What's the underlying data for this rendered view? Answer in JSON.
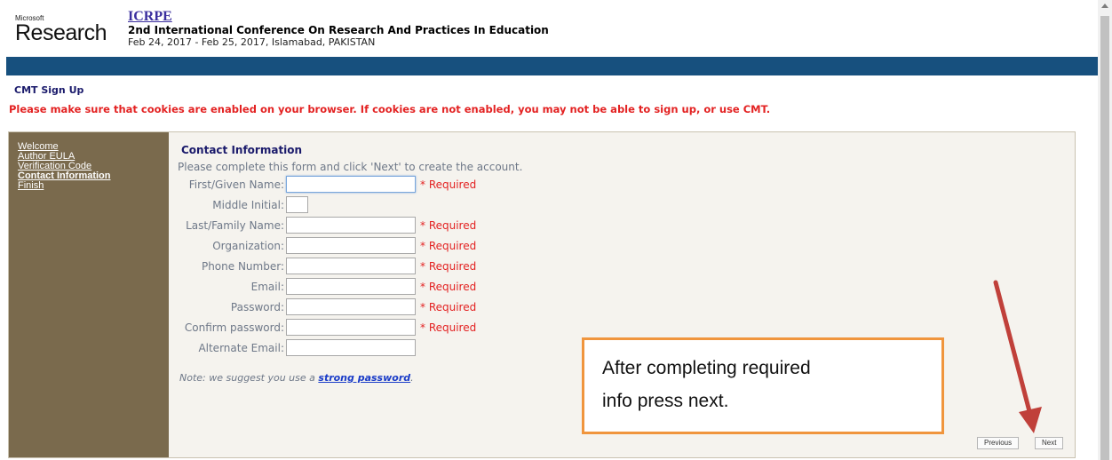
{
  "header": {
    "logo_small": "Microsoft",
    "logo_big": "Research",
    "conference_acronym": "ICRPE",
    "conference_name": "2nd International Conference On Research And Practices In Education",
    "conference_dates": "Feb 24, 2017 - Feb 25, 2017, Islamabad, PAKISTAN"
  },
  "page_title": "CMT Sign Up",
  "warning": "Please make sure that cookies are enabled on your browser. If cookies are not enabled, you may not be able to sign up, or use CMT.",
  "sidebar": {
    "items": [
      {
        "label": "Welcome"
      },
      {
        "label": "Author EULA"
      },
      {
        "label": "Verification Code"
      },
      {
        "label": "Contact Information"
      },
      {
        "label": "Finish"
      }
    ]
  },
  "form": {
    "title": "Contact Information",
    "instructions": "Please complete this form and click 'Next' to create the account.",
    "required_text": "* Required",
    "fields": [
      {
        "label": "First/Given Name:",
        "value": ""
      },
      {
        "label": "Middle Initial:",
        "value": ""
      },
      {
        "label": "Last/Family Name:",
        "value": ""
      },
      {
        "label": "Organization:",
        "value": ""
      },
      {
        "label": "Phone Number:",
        "value": ""
      },
      {
        "label": "Email:",
        "value": ""
      },
      {
        "label": "Password:",
        "value": ""
      },
      {
        "label": "Confirm password:",
        "value": ""
      },
      {
        "label": "Alternate Email:",
        "value": ""
      }
    ],
    "note_prefix": "Note: we suggest you use a ",
    "note_link": "strong password",
    "note_suffix": "."
  },
  "buttons": {
    "previous": "Previous",
    "next": "Next"
  },
  "callout": {
    "line1": "After completing required",
    "line2": "info press next."
  },
  "colors": {
    "header_bar": "#17507e",
    "sidebar_bg": "#7a6a4d",
    "warning_red": "#e32222",
    "callout_border": "#f0953d",
    "arrow": "#c0403a"
  }
}
